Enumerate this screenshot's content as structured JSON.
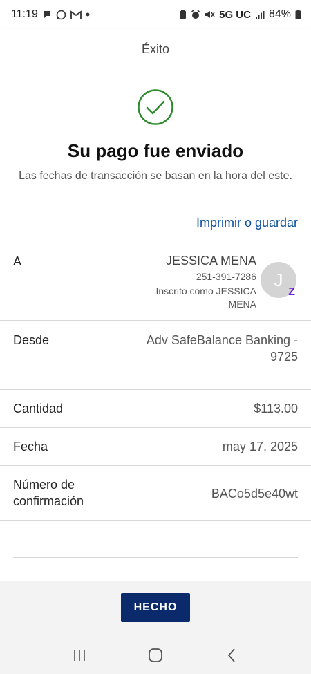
{
  "status_bar": {
    "time": "11:19",
    "network": "5G UC",
    "battery": "84%",
    "left_icons": [
      "chat-icon",
      "whatsapp-icon",
      "gmail-icon",
      "dot-icon"
    ],
    "right_icons": [
      "clipboard-icon",
      "alarm-icon",
      "mute-icon",
      "signal-icon",
      "battery-icon"
    ]
  },
  "header": {
    "title": "Éxito"
  },
  "hero": {
    "title": "Su pago fue enviado",
    "subtitle": "Las fechas de transacción se basan en la hora del este.",
    "print_link": "Imprimir o guardar",
    "accent_color": "#2e8b2e"
  },
  "details": {
    "to": {
      "label": "A",
      "name": "JESSICA MENA",
      "phone": "251-391-7286",
      "enrolled": "Inscrito como JESSICA MENA",
      "avatar_initial": "J",
      "badge": "Z"
    },
    "from": {
      "label": "Desde",
      "value": "Adv SafeBalance Banking - 9725"
    },
    "amount": {
      "label": "Cantidad",
      "value": "$113.00"
    },
    "date": {
      "label": "Fecha",
      "value": "may 17, 2025"
    },
    "confirmation": {
      "label": "Número de confirmación",
      "value": "BACo5d5e40wt"
    }
  },
  "actions": {
    "done_label": "HECHO",
    "done_color": "#0b2a6b"
  },
  "nav": {
    "icons": [
      "recents-icon",
      "home-icon",
      "back-icon"
    ]
  }
}
